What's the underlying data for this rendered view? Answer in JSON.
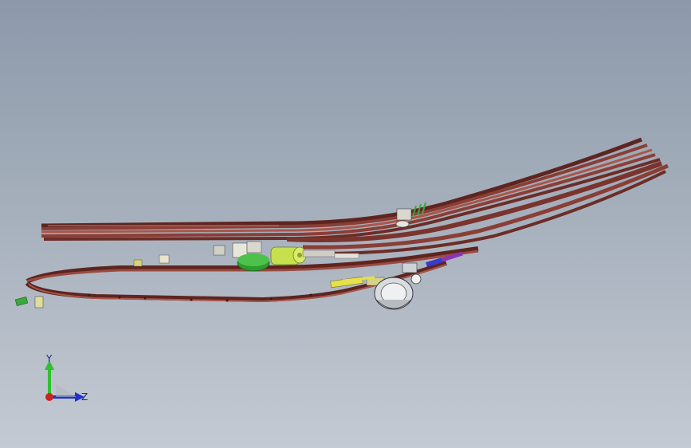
{
  "viewport": {
    "background_top": "#8c99aa",
    "background_bottom": "#c4cad3"
  },
  "model": {
    "harness_color": "#8a3e36",
    "harness_highlight": "#b86a5e",
    "harness_shadow": "#5e2520",
    "component_green": "#b5d64a",
    "component_yellow": "#e6e04a",
    "component_blue": "#3a3acc",
    "component_purple": "#8a34b8",
    "clip_green": "#3ba83b"
  },
  "triad": {
    "y_label": "Y",
    "z_label": "Z",
    "y_color": "#2fbf2f",
    "z_color": "#2233cc",
    "x_color": "#cc2222"
  }
}
